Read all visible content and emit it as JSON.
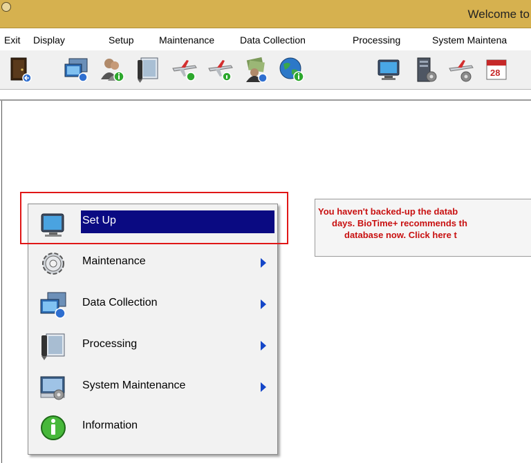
{
  "window": {
    "title": "Welcome to"
  },
  "menubar": {
    "items": [
      {
        "label": "Exit"
      },
      {
        "label": "Display"
      },
      {
        "label": "Setup"
      },
      {
        "label": "Maintenance"
      },
      {
        "label": "Data Collection"
      },
      {
        "label": "Processing"
      },
      {
        "label": "System Maintena"
      }
    ]
  },
  "toolbar": {
    "buttons": [
      {
        "icon": "exit-door-icon"
      },
      {
        "icon": "display-monitor-icon"
      },
      {
        "icon": "users-info-icon"
      },
      {
        "icon": "processing-pen-icon"
      },
      {
        "icon": "plane-green-icon"
      },
      {
        "icon": "plane-info-icon"
      },
      {
        "icon": "money-user-icon"
      },
      {
        "icon": "globe-icon"
      },
      {
        "icon": "monitor-icon"
      },
      {
        "icon": "server-gear-icon"
      },
      {
        "icon": "plane-gear-icon"
      },
      {
        "icon": "calendar-icon"
      }
    ]
  },
  "popup_menu": {
    "items": [
      {
        "label": "Set Up",
        "icon": "monitor-icon",
        "submenu": false,
        "selected": true
      },
      {
        "label": "Maintenance",
        "icon": "gear-icon",
        "submenu": true
      },
      {
        "label": "Data Collection",
        "icon": "data-collection-icon",
        "submenu": true
      },
      {
        "label": "Processing",
        "icon": "processing-pen-icon",
        "submenu": true
      },
      {
        "label": "System Maintenance",
        "icon": "system-maintenance-icon",
        "submenu": true
      },
      {
        "label": "Information",
        "icon": "info-icon",
        "submenu": false
      }
    ]
  },
  "backup_notice": {
    "lines": [
      "You haven't backed-up the datab",
      "days. BioTime+ recommends th",
      "database now. Click here t"
    ]
  },
  "colors": {
    "titlebar": "#d6b14f",
    "selection": "#0a0a82",
    "notice_text": "#c81010",
    "highlight_box": "#e01616"
  }
}
